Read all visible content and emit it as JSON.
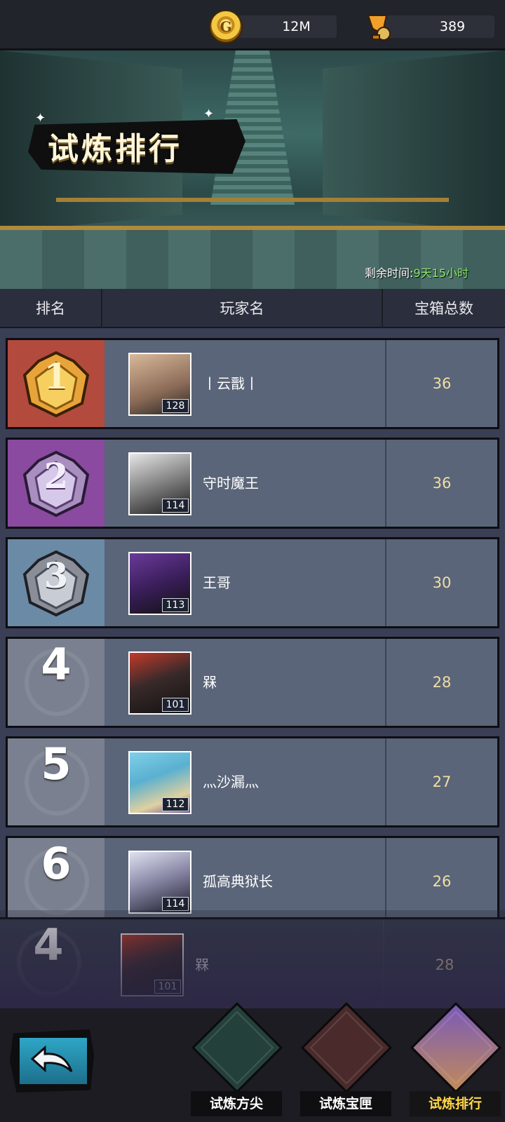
{
  "currency": {
    "gold": {
      "icon": "gold-coin-icon",
      "value": "12M"
    },
    "trophy": {
      "icon": "trophy-icon",
      "value": "389"
    }
  },
  "banner": {
    "title": "试炼排行",
    "remaining_label": "剩余时间:",
    "remaining_value": "9天15小时"
  },
  "table": {
    "headers": {
      "rank": "排名",
      "player": "玩家名",
      "chests": "宝箱总数"
    },
    "rows": [
      {
        "rank": "1",
        "name": "丨云戬丨",
        "level": "128",
        "chests": "36",
        "rank_color": "#b34a3e",
        "avatar": "avatar-beige-hair"
      },
      {
        "rank": "2",
        "name": "守时魔王",
        "level": "114",
        "chests": "36",
        "rank_color": "#8a4aa0",
        "avatar": "avatar-white-hair"
      },
      {
        "rank": "3",
        "name": "王哥",
        "level": "113",
        "chests": "30",
        "rank_color": "#6b8aa6",
        "avatar": "avatar-purple-hood"
      },
      {
        "rank": "4",
        "name": "槑",
        "level": "101",
        "chests": "28",
        "rank_color": "#7a8090",
        "avatar": "avatar-red-horns"
      },
      {
        "rank": "5",
        "name": "灬沙漏灬",
        "level": "112",
        "chests": "27",
        "rank_color": "#7a8090",
        "avatar": "avatar-blue-dino"
      },
      {
        "rank": "6",
        "name": "孤高典狱长",
        "level": "114",
        "chests": "26",
        "rank_color": "#7a8090",
        "avatar": "avatar-silver-horns"
      }
    ],
    "self_row": {
      "rank": "4",
      "name": "槑",
      "level": "101",
      "chests": "28",
      "avatar": "avatar-red-horns"
    }
  },
  "nav": {
    "back_icon": "back-arrow-icon",
    "tabs": [
      {
        "label": "试炼方尖",
        "icon": "obelisk-icon",
        "active": false
      },
      {
        "label": "试炼宝匣",
        "icon": "treasure-chest-icon",
        "active": false
      },
      {
        "label": "试炼排行",
        "icon": "throne-icon",
        "active": true
      }
    ]
  },
  "colors": {
    "accent_gold": "#ffd648",
    "chest_count": "#f1dfa3",
    "timer_green": "#8be86a"
  }
}
